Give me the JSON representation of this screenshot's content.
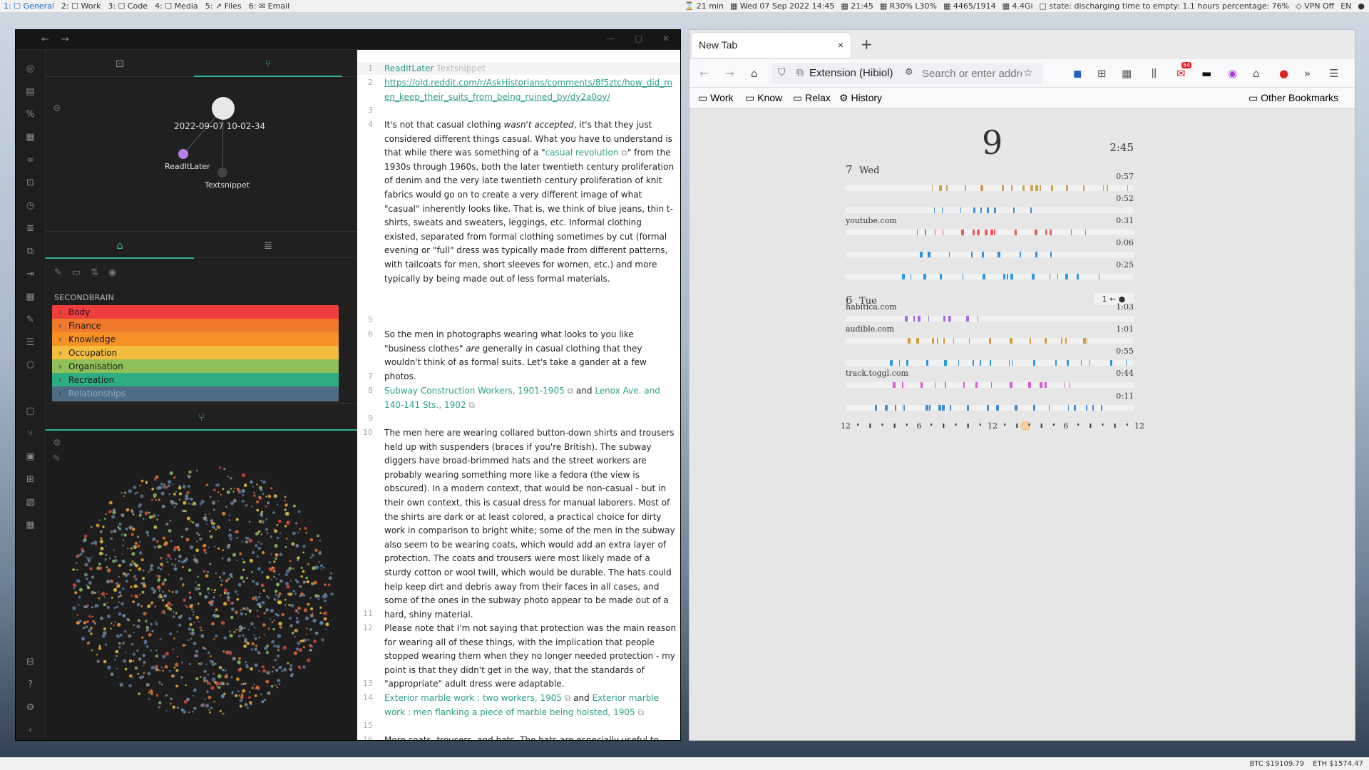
{
  "topbar": {
    "workspaces": [
      {
        "label": "1: ☐ General",
        "active": true
      },
      {
        "label": "2: ☐ Work"
      },
      {
        "label": "3: ☐ Code"
      },
      {
        "label": "4: ☐ Media"
      },
      {
        "label": "5: ↗ Files"
      },
      {
        "label": "6: ✉ Email"
      }
    ],
    "status": [
      "⌛ 21 min",
      "▦ Wed 07 Sep 2022 14:45",
      "▦ 21:45",
      "▦ R30% L30%",
      "▦ 4465/1914",
      "▦ 4.4Gi",
      "□ state: discharging time to empty: 1.1 hours percentage: 76%",
      "◇ VPN Off",
      "EN",
      "●"
    ]
  },
  "bottombar": {
    "btc": "BTC $19109.79",
    "eth": "ETH $1574.47"
  },
  "obsidian": {
    "local_graph": {
      "center_label": "2022-09-07 10-02-34",
      "node1": "ReadItLater",
      "node2": "Textsnippet"
    },
    "vault_name": "SECONDBRAIN",
    "folders": [
      {
        "label": "Body",
        "color": "#ef3e3e"
      },
      {
        "label": "Finance",
        "color": "#f07a2c"
      },
      {
        "label": "Knowledge",
        "color": "#f59127"
      },
      {
        "label": "Occupation",
        "color": "#f4bd3f"
      },
      {
        "label": "Organisation",
        "color": "#8fbf58"
      },
      {
        "label": "Recreation",
        "color": "#2fad82"
      },
      {
        "label": "Relationships",
        "color": "#4d6d86"
      }
    ],
    "editor": {
      "line1_tag1": "ReadItLater",
      "line1_tag2": "Textsnippet",
      "line2_url": "https://old.reddit.com/r/AskHistorians/comments/8f5ztc/how_did_men_keep_their_suits_from_being_ruined_by/dy2a0oy/",
      "p4_a": "It's not that casual clothing ",
      "p4_em": "wasn't accepted",
      "p4_b": ", it's that they just considered different things casual. What you have to understand is that while there was something of a \"",
      "p4_link": "casual revolution",
      "p4_c": "\" from the 1930s through 1960s, both the later twentieth century proliferation of denim and the very late twentieth century proliferation of knit fabrics would go on to create a very different image of what \"casual\" inherently looks like. That is, we think of blue jeans, thin t-shirts, sweats and sweaters, leggings, etc. Informal clothing existed, separated from formal clothing sometimes by cut (formal evening or \"full\" dress was typically made from different patterns, with tailcoats for men, short sleeves for women, etc.) and more typically by being made out of less formal materials.",
      "p6_a": "So the men in photographs wearing what looks to you like \"business clothes\" ",
      "p6_em": "are",
      "p6_b": " generally in casual clothing that they wouldn't think of as formal suits. Let's take a gander at a few photos.",
      "p8_link1": "Subway Construction Workers, 1901-1905",
      "p8_and": " and ",
      "p8_link2": "Lenox Ave. and 140-141 Sts., 1902",
      "p10": "The men here are wearing collared button-down shirts and trousers held up with suspenders (braces if you're British). The subway diggers have broad-brimmed hats and the street workers are probably wearing something more like a fedora (the view is obscured). In a modern context, that would be non-casual - but in their own context, this is casual dress for manual laborers. Most of the shirts are dark or at least colored, a practical choice for dirty work in comparison to bright white; some of the men in the subway also seem to be wearing coats, which would add an extra layer of protection. The coats and trousers were most likely made of a sturdy cotton or wool twill, which would be durable. The hats could help keep dirt and debris away from their faces in all cases, and some of the ones in the subway photo appear to be made out of a hard, shiny material.",
      "p12": "Please note that I'm not saying that protection was the main reason for wearing all of these things, with the implication that people stopped wearing them when they no longer needed protection - my point is that they didn't get in the way, that the standards of \"appropriate\" adult dress were adaptable.",
      "p14_link1": "Exterior marble work : two workers, 1905",
      "p14_and": " and ",
      "p14_link2": "Exterior marble work : men flanking a piece of marble being hoisted, 1905",
      "p16": "More coats, trousers, and hats. The hats are especially useful to these men, being outside and in full sun. You can see that the jacket of the",
      "line_numbers": [
        "1",
        "2",
        "3",
        "4",
        "5",
        "6",
        "7",
        "8",
        "9",
        "10",
        "11",
        "12",
        "13",
        "14",
        "15",
        "16"
      ]
    }
  },
  "firefox": {
    "tab_title": "New Tab",
    "tab_close": "×",
    "new_tab": "+",
    "urlbar_ext": "Extension (Hibiol)",
    "urlbar_placeholder": "Search or enter address",
    "badge_count": "54",
    "bookmarks": [
      "Work",
      "Know",
      "Relax",
      "History"
    ],
    "other_bookmarks": "Other Bookmarks",
    "dashboard": {
      "big_day": "9",
      "clock": "2:45",
      "day1": {
        "num": "7",
        "name": "Wed"
      },
      "day2": {
        "num": "6",
        "name": "Tue"
      },
      "toggle_label": "1 ← ●",
      "rows": [
        {
          "label": "",
          "time": "0:57",
          "color": "#c9a24f"
        },
        {
          "label": "",
          "time": "0:52",
          "color": "#3d8fe0"
        },
        {
          "label": "youtube.com",
          "time": "0:31",
          "color": "#ef5b5b"
        },
        {
          "label": "",
          "time": "0:06",
          "color": "#2b93e6"
        },
        {
          "label": "",
          "time": "0:25",
          "color": "#2b9be6"
        },
        {
          "label": "habitica.com",
          "time": "1:03",
          "color": "#a66ae3"
        },
        {
          "label": "audible.com",
          "time": "1:01",
          "color": "#d99a3a"
        },
        {
          "label": "",
          "time": "0:55",
          "color": "#2b9be6"
        },
        {
          "label": "track.toggl.com",
          "time": "0:44",
          "color": "#e05ad8"
        },
        {
          "label": "",
          "time": "0:11",
          "color": "#3d8fe0"
        }
      ],
      "axis_labels": [
        "12",
        "6",
        "12",
        "6",
        "12"
      ]
    }
  }
}
